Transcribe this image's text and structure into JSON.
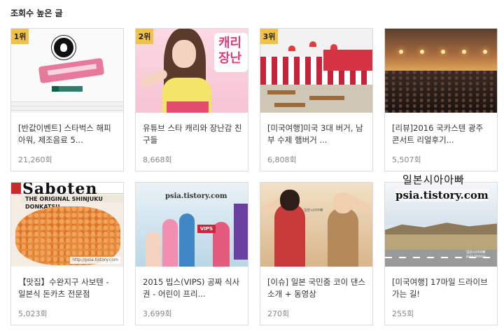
{
  "section": {
    "title": "조회수 높은 글"
  },
  "posts": [
    {
      "rank": "1위",
      "title": "[반값이벤트] 스타벅스 해피아워, 제조음료 5...",
      "views": "21,260회"
    },
    {
      "rank": "2위",
      "title": "유튜브 스타 캐리와 장난감 친구들",
      "views": "8,668회"
    },
    {
      "rank": "3위",
      "title": "[미국여행]미국 3대 버거, 남부 수제 햄버거 ...",
      "views": "6,808회"
    },
    {
      "rank": "",
      "title": "[리뷰]2016 국카스텐 광주 콘서트 리얼후기...",
      "views": "5,507회"
    },
    {
      "rank": "",
      "title": "【맛집】수완지구 사보텐 - 일본식 돈카츠 전문점",
      "views": "5,023회"
    },
    {
      "rank": "",
      "title": "2015 빕스(VIPS) 공짜 식사권 - 어린이 프리...",
      "views": "3,699회"
    },
    {
      "rank": "",
      "title": "[이슈] 일본 국민줌 코이 댄스 소개 + 동영상",
      "views": "270회"
    },
    {
      "rank": "",
      "title": "[미국여행] 17마일 드라이브 가는 길!",
      "views": "255회"
    }
  ],
  "thumbs": {
    "t2_sign": "캐리 장난",
    "t5_banner": "Saboten",
    "t5_subtitle": "THE ORIGINAL SHINJUKU DONKATSU",
    "t5_caption": "http://psia.tistory.com",
    "t6_watermark": "psia.tistory.com",
    "t6_vips": "VIPS",
    "t7_watermark": "일본시아아빠",
    "t8_signature": "일본시아아빠 psia.tistory"
  },
  "overlay": {
    "korean_text": "일본시아아빠",
    "url_text": "psia.tistory.com"
  },
  "colors": {
    "rank_badge": "#f0c14b",
    "border": "#dcdcdc",
    "views": "#888888"
  }
}
